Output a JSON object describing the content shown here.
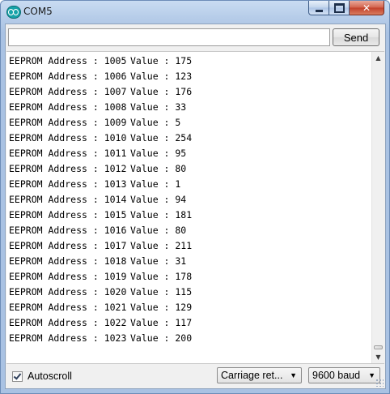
{
  "window": {
    "title": "COM5",
    "controls": {
      "minimize": "minimize",
      "maximize": "maximize",
      "close": "✕"
    }
  },
  "input": {
    "value": "",
    "send_label": "Send"
  },
  "output": {
    "lines": [
      {
        "label": "EEPROM Address : 1005",
        "value": "Value : 175"
      },
      {
        "label": "EEPROM Address : 1006",
        "value": "Value : 123"
      },
      {
        "label": "EEPROM Address : 1007",
        "value": "Value : 176"
      },
      {
        "label": "EEPROM Address : 1008",
        "value": "Value : 33"
      },
      {
        "label": "EEPROM Address : 1009",
        "value": "Value : 5"
      },
      {
        "label": "EEPROM Address : 1010",
        "value": "Value : 254"
      },
      {
        "label": "EEPROM Address : 1011",
        "value": "Value : 95"
      },
      {
        "label": "EEPROM Address : 1012",
        "value": "Value : 80"
      },
      {
        "label": "EEPROM Address : 1013",
        "value": "Value : 1"
      },
      {
        "label": "EEPROM Address : 1014",
        "value": "Value : 94"
      },
      {
        "label": "EEPROM Address : 1015",
        "value": "Value : 181"
      },
      {
        "label": "EEPROM Address : 1016",
        "value": "Value : 80"
      },
      {
        "label": "EEPROM Address : 1017",
        "value": "Value : 211"
      },
      {
        "label": "EEPROM Address : 1018",
        "value": "Value : 31"
      },
      {
        "label": "EEPROM Address : 1019",
        "value": "Value : 178"
      },
      {
        "label": "EEPROM Address : 1020",
        "value": "Value : 115"
      },
      {
        "label": "EEPROM Address : 1021",
        "value": "Value : 129"
      },
      {
        "label": "EEPROM Address : 1022",
        "value": "Value : 117"
      },
      {
        "label": "EEPROM Address : 1023",
        "value": "Value : 200"
      }
    ]
  },
  "footer": {
    "autoscroll_label": "Autoscroll",
    "autoscroll_checked": true,
    "line_ending": "Carriage ret...",
    "baud": "9600 baud"
  },
  "icons": {
    "app": "arduino-icon",
    "scroll_up": "▲",
    "scroll_down": "▼",
    "caret": "▼"
  }
}
